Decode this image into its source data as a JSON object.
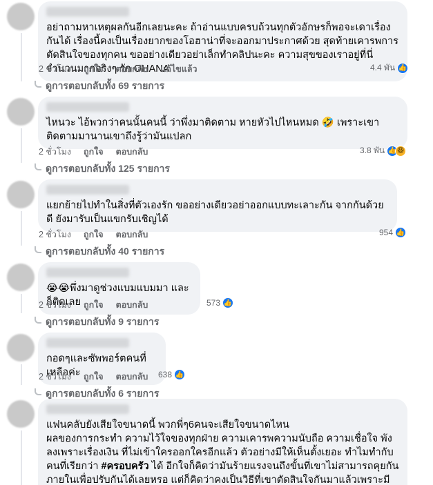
{
  "comments": [
    {
      "text": "อย่าถามหาเหตุผลกันอีกเลยนะคะ ถ้าอ่านแบบครบถ้วนทุกตัวอักษรก็พอจะเดาเรื่องกันได้ เรื่องนี้คงเป็นเรื่องยากของโอฮาน่าที่จะออกมาประกาศด้วย สุดท้ายเคารพการตัดสินใจของทุกคน ขออย่างเดียวอย่าเล็กทำคลิปนะคะ ความสุขของเราอยู่ที่นี่จำนวนมากจริงๆ รัก OHANA",
      "time": "2 ชั่วโมง",
      "like": "ถูกใจ",
      "reply": "ตอบกลับ",
      "edited": "แก้ไขแล้ว",
      "reaction_count": "4.4 พัน",
      "replies_label": "ดูการตอบกลับทั้ง 69 รายการ"
    },
    {
      "text": "ไหนวะ ไอ้พวกว่าคนนั้นคนนี้ ว่าพึ่งมาติดตาม หายหัวไปไหนหมด 🤣 เพราะเขาติดตามมานานเขาถึงรู้ว่ามันแปลก",
      "time": "2 ชั่วโมง",
      "like": "ถูกใจ",
      "reply": "ตอบกลับ",
      "reaction_count": "3.8 พัน",
      "replies_label": "ดูการตอบกลับทั้ง 125 รายการ"
    },
    {
      "text": "แยกย้ายไปทำในสิ่งที่ตัวเองรัก ขออย่างเดียวอย่าออกแบบทะเลาะกัน จากกันด้วยดี ยังมารับเป็นแขกรับเชิญได้",
      "time": "2 ชั่วโมง",
      "like": "ถูกใจ",
      "reply": "ตอบกลับ",
      "reaction_count": "954",
      "replies_label": "ดูการตอบกลับทั้ง 40 รายการ"
    },
    {
      "text": "😭😭พึ่งมาดูช่วงแบมแบมมา และก็ติดเลย",
      "time": "2 ชั่วโมง",
      "like": "ถูกใจ",
      "reply": "ตอบกลับ",
      "reaction_count": "573",
      "replies_label": "ดูการตอบกลับทั้ง 9 รายการ"
    },
    {
      "text": "กอดๆและซัพพอร์ตคนที่เหลือค่ะ",
      "time": "2 ชั่วโมง",
      "like": "ถูกใจ",
      "reply": "ตอบกลับ",
      "reaction_count": "638",
      "replies_label": "ดูการตอบกลับทั้ง 6 รายการ"
    },
    {
      "text_a": "แฟนคลับยังเสียใจขนาดนี้ พวกพี่ๆ6คนจะเสียใจขนาดไหน",
      "text_b": "ผลของการกระทำ ความไว้ใจของทุกฝ่าย ความเคารพความนับถือ ความเชื่อใจ พังลงเพราะเรื่องเงิน ที่ไม่เข้าใครออกใครอีกแล้ว ตัวอย่างมีให้เห็นตั้งเยอะ ทำไมทำกับคนที่เรียกว่า",
      "hashtag": "#ครอบครัว",
      "text_c": " ได้ อีกใจก็คิดว่ามันร้ายแรงจนถึงขั้นที่เขาไม่สามารถคุยกันภายในเพื่อปรับกันได้เลยหรอ แต่ก็คิดว่าคงเป็นวิธีที่เขาตัดสินใจกันมาแล้วเพราะมีเรื่องของกฎหมาย ละเลือกที่จะประกาศในตอนเช้าเลย ก็คง"
    }
  ],
  "colors": {
    "bubble": "#f0f2f5",
    "meta": "#65676b",
    "like_blue": "#1877f2",
    "haha_yellow": "#f7b125"
  },
  "icons": {
    "like": "like-icon",
    "haha": "haha-icon"
  }
}
